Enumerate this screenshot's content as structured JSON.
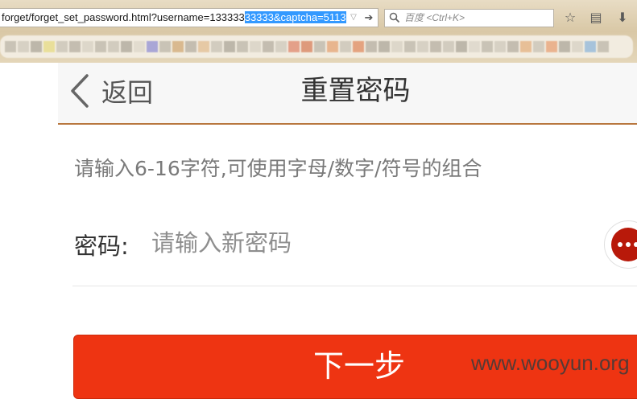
{
  "browser": {
    "url_normal": "forget/forget_set_password.html?username=133333",
    "url_selected": "33333&captcha=5113",
    "search_placeholder": "百度 <Ctrl+K>"
  },
  "page": {
    "back_label": "返回",
    "title": "重置密码",
    "hint": "请输入6-16字符,可使用字母/数字/符号的组合",
    "password": {
      "label": "密码:",
      "placeholder": "请输入新密码",
      "value": ""
    },
    "next_label": "下一步"
  },
  "watermark": "www.wooyun.org",
  "colors": {
    "accent": "#ee3412",
    "header_border": "#b8773e",
    "fab": "#b8190a"
  },
  "icons": {
    "back": "chevron-left-icon",
    "more": "more-dots-icon",
    "star": "star-icon",
    "reader": "reader-icon",
    "download": "download-icon"
  }
}
